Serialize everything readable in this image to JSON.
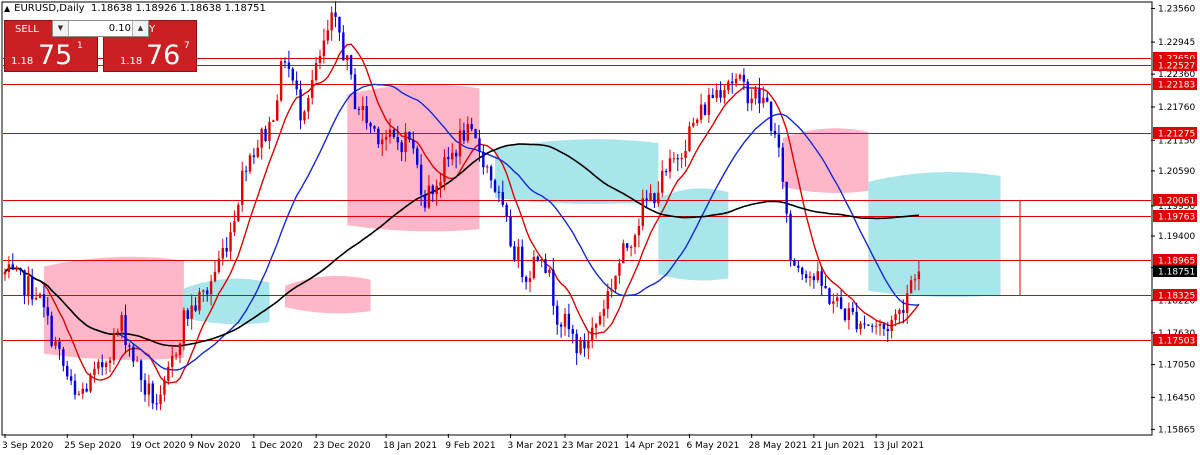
{
  "title": {
    "symbol_timeframe": "EURUSD,Daily",
    "ohlc": "1.18638 1.18926 1.18638 1.18751"
  },
  "trade_panel": {
    "sell": {
      "label": "SELL",
      "prefix": "1.18",
      "big": "75",
      "sup": "1"
    },
    "buy": {
      "label": "BUY",
      "prefix": "1.18",
      "big": "76",
      "sup": "7"
    },
    "lot": {
      "value": "0.10"
    }
  },
  "colors": {
    "background": "#ffffff",
    "bull_candle": "#e00000",
    "bear_candle": "#0000dd",
    "level_line": "#e00000",
    "ma_fast": "#e00000",
    "ma_mid": "#1428d8",
    "ma_slow": "#000000",
    "cloud_bear": "#ffb6c8",
    "cloud_bull": "#a8e6ec",
    "current_price_tag": "#000000"
  },
  "chart_data": {
    "type": "candlestick",
    "symbol": "EURUSD",
    "timeframe": "Daily",
    "ylim": [
      1.1578,
      1.2366
    ],
    "y_ticks": [
      "1.23560",
      "1.22945",
      "1.22360",
      "1.21760",
      "1.21150",
      "1.20590",
      "1.19950",
      "1.19400",
      "1.18820",
      "1.18220",
      "1.17630",
      "1.17050",
      "1.16450",
      "1.15865"
    ],
    "x_ticks": [
      "3 Sep 2020",
      "25 Sep 2020",
      "19 Oct 2020",
      "9 Nov 2020",
      "1 Dec 2020",
      "23 Dec 2020",
      "18 Jan 2021",
      "9 Feb 2021",
      "3 Mar 2021",
      "23 Mar 2021",
      "14 Apr 2021",
      "6 May 2021",
      "28 May 2021",
      "21 Jun 2021",
      "13 Jul 2021"
    ],
    "x_tick_bars": [
      0,
      16,
      33,
      48,
      64,
      80,
      98,
      114,
      130,
      144,
      160,
      176,
      192,
      208,
      224
    ],
    "bar_count": 236,
    "future_bars": 26,
    "current_price": "1.18751",
    "current_price_value": 1.18751,
    "levels": [
      {
        "label": "1.22650",
        "value": 1.2265
      },
      {
        "label": "1.22527",
        "value": 1.22527
      },
      {
        "label": "1.22183",
        "value": 1.22183
      },
      {
        "label": "1.21275",
        "value": 1.21275
      },
      {
        "label": "1.20061",
        "value": 1.20061
      },
      {
        "label": "1.19763",
        "value": 1.19763
      },
      {
        "label": "1.18965",
        "value": 1.18965
      },
      {
        "label": "1.18325",
        "value": 1.18325
      },
      {
        "label": "1.17503",
        "value": 1.17503
      }
    ],
    "price_path": [
      [
        0,
        1.187
      ],
      [
        8,
        1.184
      ],
      [
        14,
        1.172
      ],
      [
        18,
        1.164
      ],
      [
        24,
        1.169
      ],
      [
        30,
        1.178
      ],
      [
        36,
        1.166
      ],
      [
        40,
        1.163
      ],
      [
        46,
        1.179
      ],
      [
        52,
        1.184
      ],
      [
        58,
        1.195
      ],
      [
        62,
        1.208
      ],
      [
        68,
        1.214
      ],
      [
        72,
        1.227
      ],
      [
        76,
        1.217
      ],
      [
        80,
        1.224
      ],
      [
        84,
        1.233
      ],
      [
        86,
        1.231
      ],
      [
        90,
        1.219
      ],
      [
        94,
        1.214
      ],
      [
        100,
        1.211
      ],
      [
        104,
        1.212
      ],
      [
        108,
        1.201
      ],
      [
        112,
        1.205
      ],
      [
        118,
        1.213
      ],
      [
        122,
        1.21
      ],
      [
        126,
        1.203
      ],
      [
        130,
        1.193
      ],
      [
        134,
        1.187
      ],
      [
        138,
        1.192
      ],
      [
        142,
        1.18
      ],
      [
        148,
        1.173
      ],
      [
        152,
        1.178
      ],
      [
        158,
        1.189
      ],
      [
        164,
        1.199
      ],
      [
        170,
        1.205
      ],
      [
        176,
        1.213
      ],
      [
        182,
        1.22
      ],
      [
        186,
        1.223
      ],
      [
        190,
        1.221
      ],
      [
        196,
        1.218
      ],
      [
        200,
        1.205
      ],
      [
        202,
        1.19
      ],
      [
        206,
        1.188
      ],
      [
        212,
        1.183
      ],
      [
        216,
        1.18
      ],
      [
        222,
        1.178
      ],
      [
        226,
        1.177
      ],
      [
        230,
        1.18
      ],
      [
        234,
        1.188
      ],
      [
        235,
        1.1875
      ]
    ],
    "series": [
      {
        "type": "ma",
        "period_bars": 10,
        "color": "#e00000"
      },
      {
        "type": "ma",
        "period_bars": 30,
        "color": "#1428d8"
      },
      {
        "type": "ma",
        "period_bars": 80,
        "color": "#000000"
      }
    ],
    "cloud": [
      {
        "from_bar": 10,
        "to_bar": 46,
        "top": 1.1895,
        "bottom": 1.1725,
        "kind": "bear"
      },
      {
        "from_bar": 46,
        "to_bar": 68,
        "top": 1.1855,
        "bottom": 1.179,
        "kind": "bull"
      },
      {
        "from_bar": 72,
        "to_bar": 94,
        "top": 1.186,
        "bottom": 1.181,
        "kind": "bear"
      },
      {
        "from_bar": 88,
        "to_bar": 122,
        "top": 1.221,
        "bottom": 1.196,
        "kind": "bear"
      },
      {
        "from_bar": 126,
        "to_bar": 168,
        "top": 1.211,
        "bottom": 1.201,
        "kind": "bull"
      },
      {
        "from_bar": 168,
        "to_bar": 186,
        "top": 1.202,
        "bottom": 1.187,
        "kind": "bull"
      },
      {
        "from_bar": 200,
        "to_bar": 222,
        "top": 1.213,
        "bottom": 1.203,
        "kind": "bear"
      },
      {
        "from_bar": 222,
        "to_bar": 256,
        "top": 1.205,
        "bottom": 1.184,
        "kind": "bull"
      }
    ]
  }
}
